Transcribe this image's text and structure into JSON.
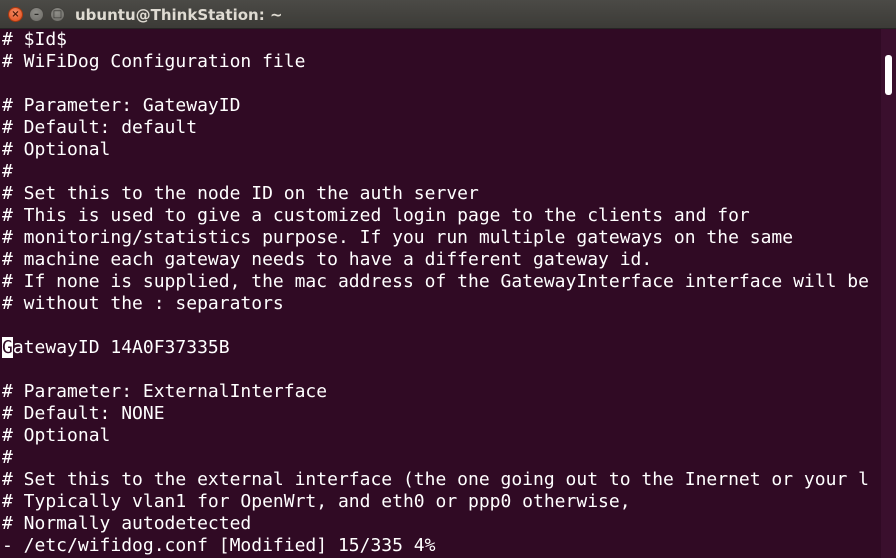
{
  "window": {
    "title": "ubuntu@ThinkStation: ~",
    "close_glyph": "×",
    "minimize_glyph": "–",
    "maximize_glyph": "□"
  },
  "terminal": {
    "background": "#300a24",
    "foreground": "#ffffff",
    "lines": [
      "# $Id$",
      "# WiFiDog Configuration file",
      "",
      "# Parameter: GatewayID",
      "# Default: default",
      "# Optional",
      "#",
      "# Set this to the node ID on the auth server",
      "# This is used to give a customized login page to the clients and for",
      "# monitoring/statistics purpose. If you run multiple gateways on the same",
      "# machine each gateway needs to have a different gateway id.",
      "# If none is supplied, the mac address of the GatewayInterface interface will be",
      "# without the : separators",
      "",
      "GatewayID 14A0F37335B",
      "",
      "# Parameter: ExternalInterface",
      "# Default: NONE",
      "# Optional",
      "#",
      "# Set this to the external interface (the one going out to the Inernet or your l",
      "# Typically vlan1 for OpenWrt, and eth0 or ppp0 otherwise,",
      "# Normally autodetected",
      "- /etc/wifidog.conf [Modified] 15/335 4%"
    ],
    "cursor": {
      "line": 14,
      "char": "G",
      "rest": "atewayID 14A0F37335B"
    }
  },
  "scrollbar": {
    "position_fraction": 0.045
  }
}
